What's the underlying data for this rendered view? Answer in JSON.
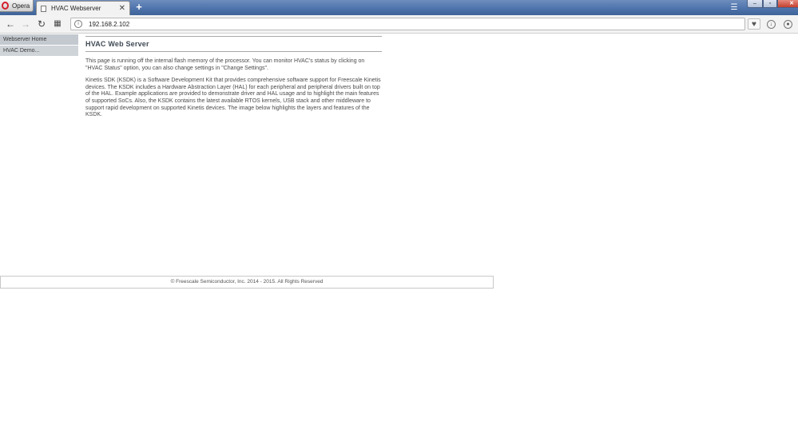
{
  "browser": {
    "menu_label": "Opera",
    "tab_title": "HVAC Webserver",
    "tab_close": "✕",
    "new_tab": "+",
    "url": "192.168.2.102"
  },
  "sidebar": {
    "items": [
      {
        "label": "Webserver Home"
      },
      {
        "label": "HVAC Demo..."
      }
    ]
  },
  "page": {
    "title": "HVAC Web Server",
    "paragraph1": "This page is running off the internal flash memory of the processor. You can monitor HVAC's status by clicking on \"HVAC Status\" option, you can also change settings in \"Change Settings\".",
    "paragraph2": "Kinetis SDK (KSDK) is a Software Development Kit that provides comprehensive software support for Freescale Kinetis devices. The KSDK includes a Hardware Abstraction Layer (HAL) for each peripheral and peripheral drivers built on top of the HAL. Example applications are provided to demonstrate driver and HAL usage and to highlight the main features of supported SoCs. Also, the KSDK contains the latest available RTOS kernels, USB stack and other middleware to support rapid development on supported Kinetis devices. The image below highlights the layers and features of the KSDK."
  },
  "footer": {
    "text": "© Freescale Semiconductor, Inc. 2014 - 2015. All Rights Reserved"
  },
  "colors": {
    "titlebar": "#4f74ad",
    "sidebar_item": "#cfd4d9",
    "opera_red": "#d51f2c"
  },
  "icons": {
    "back": "arrow-left-icon",
    "forward": "arrow-right-icon",
    "reload": "reload-icon",
    "speed_dial": "grid-icon",
    "site_info": "info-icon",
    "stash": "heart-icon",
    "downloads": "download-icon",
    "account": "account-icon",
    "tab_menu": "tab-menu-icon"
  }
}
